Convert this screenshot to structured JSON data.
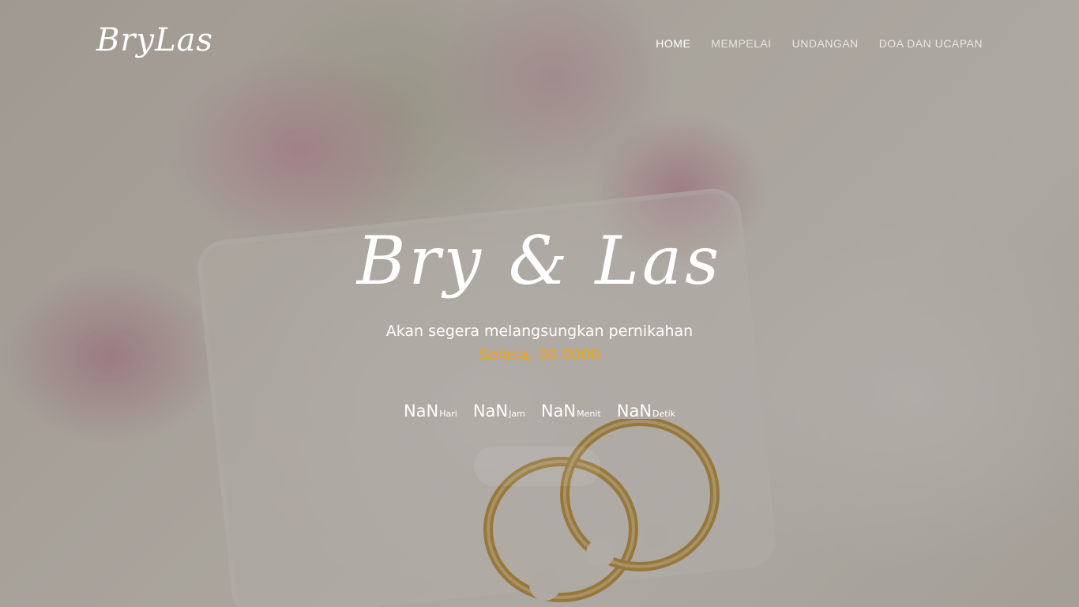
{
  "brand": {
    "logo_text": "BryLas"
  },
  "nav": {
    "items": [
      {
        "label": "HOME",
        "active": true
      },
      {
        "label": "MEMPELAI",
        "active": false
      },
      {
        "label": "UNDANGAN",
        "active": false
      },
      {
        "label": "DOA DAN UCAPAN",
        "active": false
      }
    ]
  },
  "hero": {
    "couple": "Bry & Las",
    "tagline": "Akan segera melangsungkan pernikahan",
    "date": "Selasa, 00 0000",
    "countdown": [
      {
        "value": "NaN",
        "unit": "Hari"
      },
      {
        "value": "NaN",
        "unit": "Jam"
      },
      {
        "value": "NaN",
        "unit": "Menit"
      },
      {
        "value": "NaN",
        "unit": "Detik"
      }
    ]
  },
  "colors": {
    "accent_date": "#f2a30f",
    "text": "#ffffff"
  }
}
